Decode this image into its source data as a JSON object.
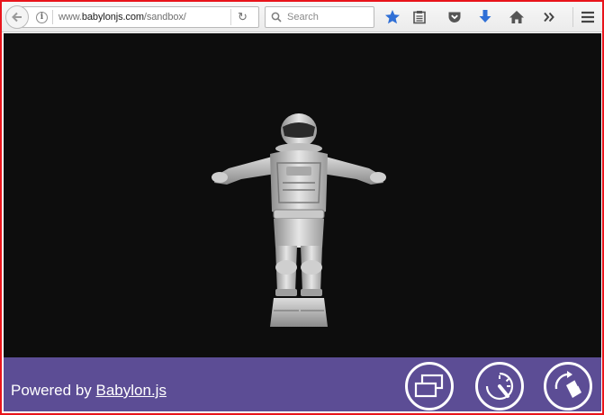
{
  "browser": {
    "url_prefix": "www.",
    "url_host": "babylonjs.com",
    "url_path": "/sandbox/",
    "search_placeholder": "Search",
    "icons": [
      "back-arrow-icon",
      "info-icon",
      "reload-icon",
      "search-icon",
      "bookmark-star-icon",
      "reading-list-icon",
      "pocket-icon",
      "downloads-icon",
      "home-icon",
      "overflow-chevron-icon",
      "hamburger-menu-icon"
    ]
  },
  "colors": {
    "frame": "#e8141b",
    "viewport_bg": "#0d0d0d",
    "footer_bg": "#5c4d95",
    "star": "#2f6fd6",
    "download": "#2f6fd6"
  },
  "footer": {
    "powered_by": "Powered by",
    "brand_link": "Babylon.js",
    "buttons": [
      "fullscreen-icon",
      "debug-layer-gauge-icon",
      "load-file-icon"
    ]
  },
  "scene": {
    "model": "astronaut-model"
  }
}
